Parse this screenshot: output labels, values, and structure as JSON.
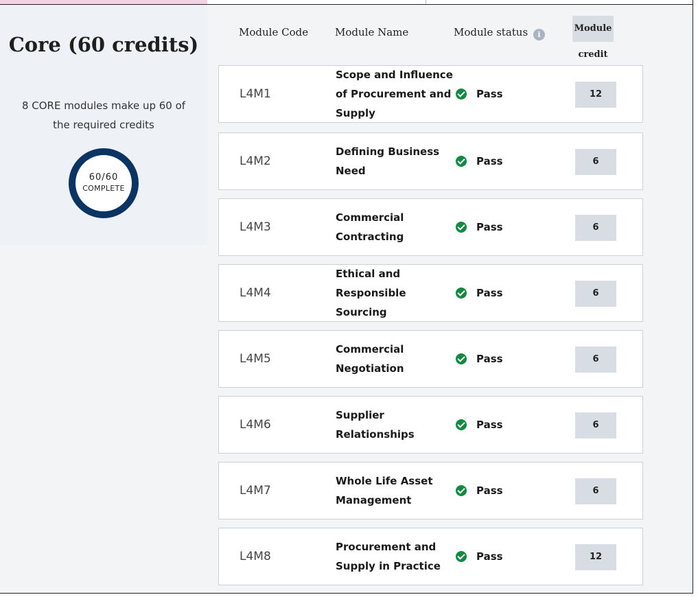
{
  "summary": {
    "title": "Core (60 credits)",
    "description": "8 CORE modules make up 60 of the required credits",
    "progress_text": "60/60",
    "progress_label": "COMPLETE",
    "progress_fraction": 1.0
  },
  "table": {
    "headers": {
      "code": "Module Code",
      "name": "Module Name",
      "status": "Module status",
      "credit": "Module credit"
    },
    "info_icon": "i",
    "rows": [
      {
        "code": "L4M1",
        "name": "Scope and Influence of Procurement and Supply",
        "status": "Pass",
        "credit": "12"
      },
      {
        "code": "L4M2",
        "name": "Defining Business Need",
        "status": "Pass",
        "credit": "6"
      },
      {
        "code": "L4M3",
        "name": "Commercial Contracting",
        "status": "Pass",
        "credit": "6"
      },
      {
        "code": "L4M4",
        "name": "Ethical and Responsible Sourcing",
        "status": "Pass",
        "credit": "6"
      },
      {
        "code": "L4M5",
        "name": "Commercial Negotiation",
        "status": "Pass",
        "credit": "6"
      },
      {
        "code": "L4M6",
        "name": "Supplier Relationships",
        "status": "Pass",
        "credit": "6"
      },
      {
        "code": "L4M7",
        "name": "Whole Life Asset Management",
        "status": "Pass",
        "credit": "6"
      },
      {
        "code": "L4M8",
        "name": "Procurement and Supply in Practice",
        "status": "Pass",
        "credit": "12"
      }
    ]
  },
  "colors": {
    "ring": "#0b3464",
    "pass": "#0f8a3f",
    "tab_accent": "#f4d2e6"
  }
}
